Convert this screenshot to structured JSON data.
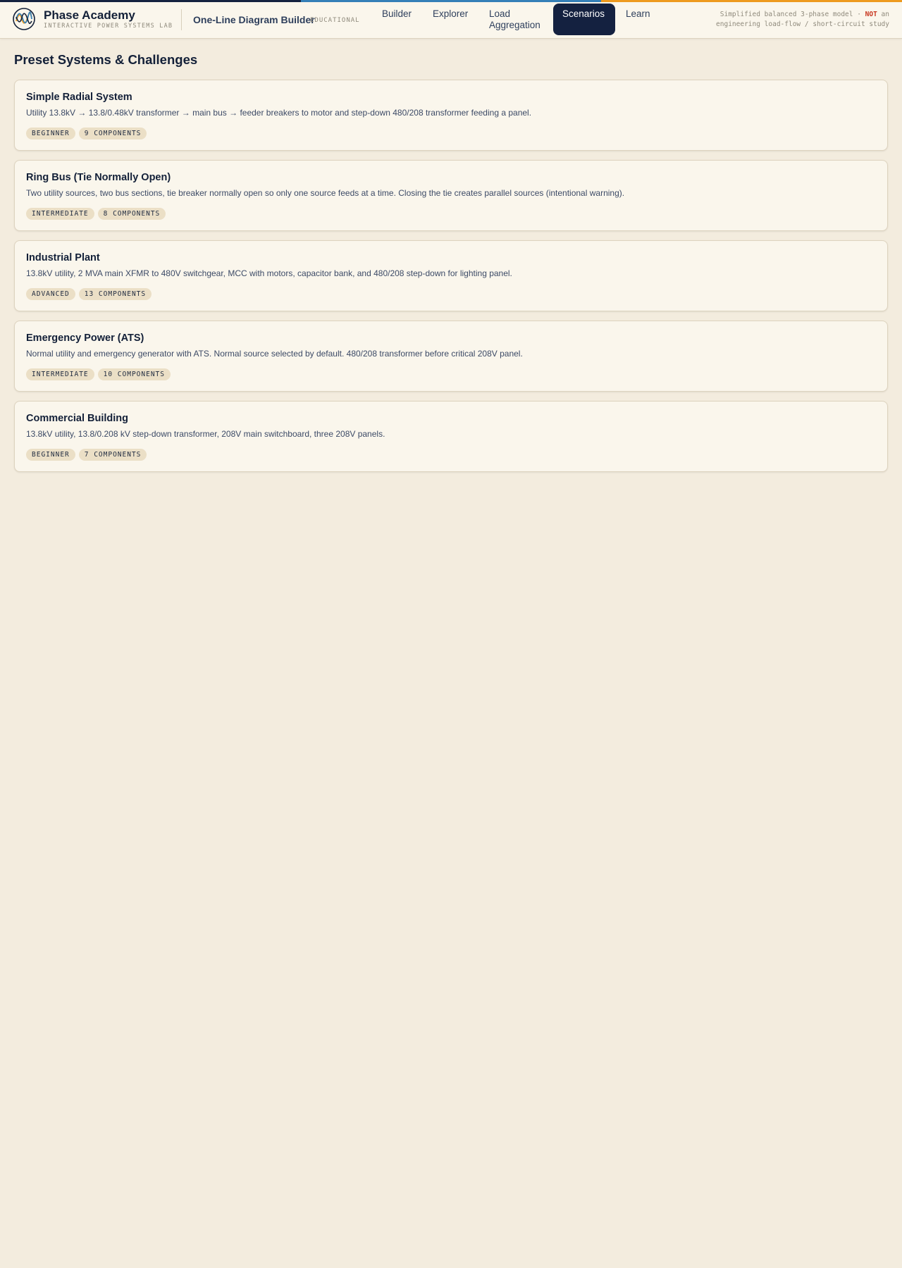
{
  "colors": {
    "accent_navy": "#152340",
    "accent_blue": "#3580b8",
    "accent_orange": "#ee9a1e",
    "background": "#f3ecde",
    "card_bg": "#faf6ec",
    "tag_bg": "#ebdfc6",
    "warn_red": "#c8361f"
  },
  "brand": {
    "logo_icon": "sine-wave-logo-icon",
    "title": "Phase Academy",
    "subtitle": "INTERACTIVE POWER SYSTEMS LAB"
  },
  "app": {
    "title": "One-Line Diagram Builder",
    "tag": "EDUCATIONAL"
  },
  "nav": {
    "builder": "Builder",
    "explorer": "Explorer",
    "load_aggregation": "Load Aggregation",
    "scenarios": "Scenarios",
    "learn": "Learn",
    "active": "Scenarios"
  },
  "disclaimer": {
    "line1_prefix": "Simplified balanced 3-phase model · ",
    "line1_emphasis": "NOT",
    "line1_suffix": " an",
    "line2": "engineering load-flow / short-circuit study"
  },
  "page": {
    "title": "Preset Systems & Challenges"
  },
  "scenarios": [
    {
      "title": "Simple Radial System",
      "description": "Utility 13.8kV → 13.8/0.48kV transformer → main bus → feeder breakers to motor and step-down 480/208 transformer feeding a panel.",
      "level": "BEGINNER",
      "components": "9 COMPONENTS"
    },
    {
      "title": "Ring Bus (Tie Normally Open)",
      "description": "Two utility sources, two bus sections, tie breaker normally open so only one source feeds at a time. Closing the tie creates parallel sources (intentional warning).",
      "level": "INTERMEDIATE",
      "components": "8 COMPONENTS"
    },
    {
      "title": "Industrial Plant",
      "description": "13.8kV utility, 2 MVA main XFMR to 480V switchgear, MCC with motors, capacitor bank, and 480/208 step-down for lighting panel.",
      "level": "ADVANCED",
      "components": "13 COMPONENTS"
    },
    {
      "title": "Emergency Power (ATS)",
      "description": "Normal utility and emergency generator with ATS. Normal source selected by default. 480/208 transformer before critical 208V panel.",
      "level": "INTERMEDIATE",
      "components": "10 COMPONENTS"
    },
    {
      "title": "Commercial Building",
      "description": "13.8kV utility, 13.8/0.208 kV step-down transformer, 208V main switchboard, three 208V panels.",
      "level": "BEGINNER",
      "components": "7 COMPONENTS"
    }
  ]
}
